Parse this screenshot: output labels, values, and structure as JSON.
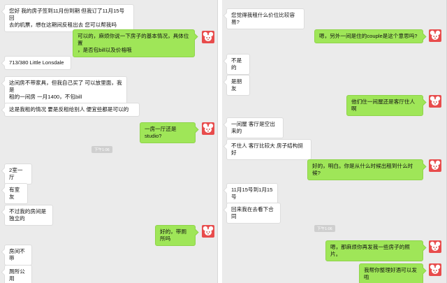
{
  "left": {
    "messages": [
      {
        "dir": "in",
        "text": "您好 我的房子签到11月份到期 但我订了11月15号回\n去的机票，想在这期间反租出去 您可以帮我吗"
      },
      {
        "dir": "out",
        "text": "可以的，麻烦你说一下房子的基本情况，具体位置\n，是否包bill以及价格哦"
      },
      {
        "dir": "in",
        "text": "713/380 Little Lonsdale"
      },
      {
        "dir": "in",
        "text": "这间房不带家具，但我自己买了 可以放里面，我是\n租的一间房 一月1400，不包bill"
      },
      {
        "dir": "in",
        "text": "这是我租的情况 要是反租给别人 便宜些都是可以的"
      },
      {
        "dir": "out",
        "text": "一房一厅还是studio?"
      },
      {
        "dir": "time",
        "text": "下午1:06"
      },
      {
        "dir": "in",
        "text": "2室一厅"
      },
      {
        "dir": "in",
        "text": "有室友"
      },
      {
        "dir": "in",
        "text": "不过我的房间是独立的"
      },
      {
        "dir": "out",
        "text": "好的，带厕所吗"
      },
      {
        "dir": "in",
        "text": "房间不带"
      },
      {
        "dir": "in",
        "text": "厕所公用"
      }
    ]
  },
  "right": {
    "messages": [
      {
        "dir": "in",
        "text": "您觉得我租什么价位比较容易?"
      },
      {
        "dir": "out",
        "text": "嗯，另外一间是住的couple是这个意思吗?"
      },
      {
        "dir": "in",
        "text": "不是的"
      },
      {
        "dir": "in",
        "text": "是朋友"
      },
      {
        "dir": "out",
        "text": "他们住一间屋还是客厅住人啊"
      },
      {
        "dir": "in",
        "text": "一间屋 客厅是空出来的"
      },
      {
        "dir": "in",
        "text": "不住人 客厅比较大 房子结构挺好"
      },
      {
        "dir": "out",
        "text": "好的，明白。你是从什么时候出租到什么时候?"
      },
      {
        "dir": "in",
        "text": "11月15号到1月15号"
      },
      {
        "dir": "in",
        "text": "回来我在去看下合同"
      },
      {
        "dir": "time",
        "text": "下午1:06"
      },
      {
        "dir": "out",
        "text": "嗯，那麻烦你再发我一些房子的照片。"
      },
      {
        "dir": "out",
        "text": "我帮你整理好酒可以发啦"
      }
    ]
  },
  "colors": {
    "out_bubble": "#9fe658",
    "in_bubble": "#ffffff",
    "avatar": "#e84c4c",
    "background": "#ebebeb"
  },
  "icons": {
    "avatar": "red-mouse-avatar-icon"
  }
}
